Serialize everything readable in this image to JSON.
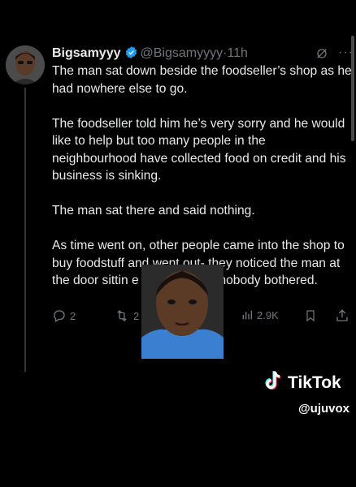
{
  "tweet": {
    "author_name": "Bigsamyyy",
    "handle": "@Bigsamyyyy",
    "separator": "·",
    "time": "11h",
    "more_label": "···",
    "paragraphs": [
      "The man sat down beside the foodseller’s shop as he had nowhere else to go.",
      "The foodseller told him he’s very sorry and he would like to help but too many people in the neighbourhood have collected food on credit and his business is sinking.",
      "The man sat there and said nothing.",
      "As time went on, other people came into the shop to buy foodstuff and went out- they noticed the man at the door sittin    e sleeping. But nobody bothered."
    ],
    "actions": {
      "replies": "2",
      "reposts": "2",
      "views": "2.9K"
    },
    "icons": {
      "verified": "verified-badge-icon",
      "grok": "grok-icon",
      "reply": "reply-icon",
      "repost": "repost-icon",
      "views": "views-icon",
      "bookmark": "bookmark-icon",
      "share": "share-icon"
    },
    "colors": {
      "verified": "#1d9bf0",
      "text": "#e7e9ea",
      "muted": "#71767b",
      "background": "#000000"
    }
  },
  "overlay": {
    "tiktok_wordmark": "TikTok",
    "tiktok_username": "@ujuvox"
  }
}
